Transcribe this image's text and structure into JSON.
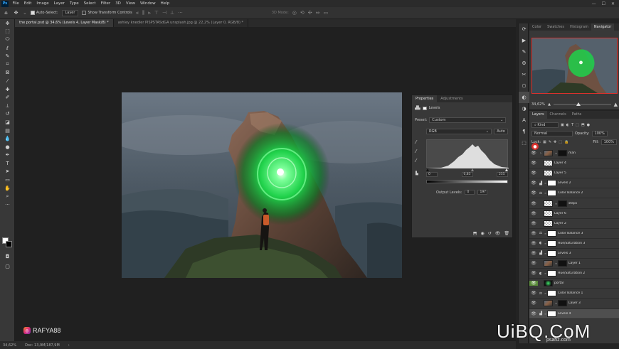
{
  "app": {
    "logo": "Ps",
    "menu": [
      "File",
      "Edit",
      "Image",
      "Layer",
      "Type",
      "Select",
      "Filter",
      "3D",
      "View",
      "Window",
      "Help"
    ],
    "window_controls": [
      "—",
      "☐",
      "✕"
    ]
  },
  "options_bar": {
    "auto_select_label": "Auto-Select:",
    "auto_select_target": "Layer",
    "show_transform_label": "Show Transform Controls",
    "mode_3d_label": "3D Mode:"
  },
  "tabs": [
    {
      "label": "the portal.psd @ 34,6% (Levels 4, Layer Mask/8) *",
      "active": true
    },
    {
      "label": "ashley knedler PISPSTASdGA unsplash.jpg @ 22,2% (Layer 0, RGB/8) *",
      "active": false
    }
  ],
  "status": {
    "zoom": "34,62%",
    "doc": "Doc: 13,9M/187,9M"
  },
  "properties": {
    "tabs": [
      "Properties",
      "Adjustments"
    ],
    "adjustment_title": "Levels",
    "preset_label": "Preset:",
    "preset_value": "Custom",
    "channel_value": "RGB",
    "auto_label": "Auto",
    "input_black": "0",
    "input_gamma": "0,83",
    "input_white": "255",
    "output_label": "Output Levels:",
    "output_black": "0",
    "output_white": "197"
  },
  "navigator": {
    "tabs": [
      "Color",
      "Swatches",
      "Histogram",
      "Navigator"
    ],
    "zoom": "34,62%"
  },
  "layers": {
    "tabs": [
      "Layers",
      "Channels",
      "Paths"
    ],
    "filter_label": "Kind",
    "blend_mode": "Normal",
    "opacity_label": "Opacity:",
    "opacity_value": "100%",
    "lock_label": "Lock:",
    "fill_label": "Fill:",
    "fill_value": "100%",
    "items": [
      {
        "name": "man",
        "type": "group",
        "selected": false
      },
      {
        "name": "Layer 4",
        "type": "pixel",
        "selected": false
      },
      {
        "name": "Layer 5",
        "type": "pixel",
        "selected": false
      },
      {
        "name": "Levels 2",
        "type": "adjustment",
        "selected": false
      },
      {
        "name": "Color Balance 2",
        "type": "adjustment",
        "selected": false
      },
      {
        "name": "steps",
        "type": "masked",
        "selected": false
      },
      {
        "name": "Layer 6",
        "type": "pixel",
        "selected": false
      },
      {
        "name": "Layer 2",
        "type": "pixel",
        "selected": false
      },
      {
        "name": "Color Balance 3",
        "type": "adjustment",
        "selected": false
      },
      {
        "name": "Hue/Saturation 3",
        "type": "adjustment",
        "selected": false
      },
      {
        "name": "Levels 3",
        "type": "adjustment",
        "selected": false
      },
      {
        "name": "Layer 1",
        "type": "photo",
        "selected": false
      },
      {
        "name": "Hue/Saturation 2",
        "type": "adjustment",
        "selected": false
      },
      {
        "name": "portal",
        "type": "glow",
        "selected": false
      },
      {
        "name": "Color Balance 1",
        "type": "adjustment",
        "selected": false
      },
      {
        "name": "Layer 3",
        "type": "photo",
        "selected": false
      },
      {
        "name": "Levels 4",
        "type": "adjustment",
        "selected": true
      }
    ]
  },
  "watermarks": {
    "instagram": "RAFYA88",
    "site": "UiBQ.CoM",
    "site2": "psahz.com"
  },
  "colors": {
    "accent_red": "#d9312d",
    "portal_green": "#3fe86b"
  }
}
